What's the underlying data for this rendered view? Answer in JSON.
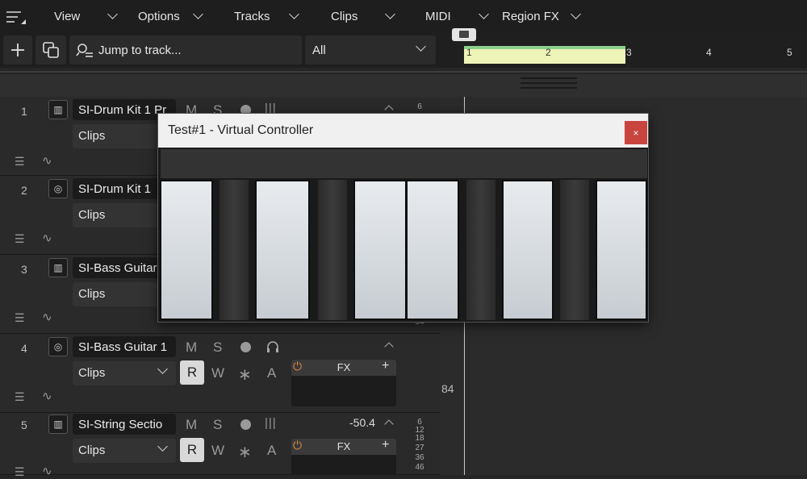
{
  "menu": {
    "view": "View",
    "options": "Options",
    "tracks": "Tracks",
    "clips": "Clips",
    "midi": "MIDI",
    "region_fx": "Region FX"
  },
  "toolbar": {
    "jump_placeholder": "Jump to track...",
    "filter_value": "All"
  },
  "ruler": {
    "marks": [
      "1",
      "2",
      "3",
      "4",
      "5"
    ]
  },
  "tracks": [
    {
      "number": "1",
      "name": "SI-Drum Kit 1 Pr",
      "clips": "Clips",
      "meter_top": "6"
    },
    {
      "number": "2",
      "name": "SI-Drum Kit 1",
      "clips": "Clips"
    },
    {
      "number": "3",
      "name": "SI-Bass Guitar",
      "clips": "Clips",
      "meter_bottom": "54"
    },
    {
      "number": "4",
      "name": "SI-Bass Guitar 1",
      "clips": "Clips",
      "fx": "FX",
      "meter_value": "84"
    },
    {
      "number": "5",
      "name": "SI-String Sectio",
      "clips": "Clips",
      "fx": "FX",
      "volume": "-50.4",
      "meter_scale": [
        "6",
        "12",
        "18",
        "27",
        "36",
        "46"
      ]
    }
  ],
  "buttons": {
    "m": "M",
    "s": "S",
    "r": "R",
    "w": "W",
    "a": "A"
  },
  "dialog": {
    "title": "Test#1 - Virtual Controller",
    "close": "×"
  }
}
